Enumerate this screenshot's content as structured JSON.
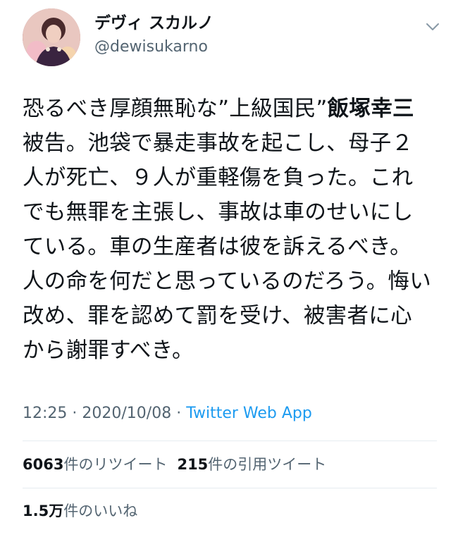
{
  "author": {
    "display_name": "デヴィ スカルノ",
    "handle": "@dewisukarno",
    "avatar_icon": "avatar-photo",
    "menu_icon": "chevron-down-icon"
  },
  "tweet": {
    "text_before": "恐るべき厚顔無恥な”上級国民”",
    "text_bold": "飯塚幸三",
    "text_after": "被告。池袋で暴走事故を起こし、母子２人が死亡、９人が重軽傷を負った。これでも無罪を主張し、事故は車のせいにしている。車の生産者は彼を訴えるべき。人の命を何だと思っているのだろう。悔い改め、罪を認めて罰を受け、被害者に心から謝罪すべき。"
  },
  "meta": {
    "time": "12:25",
    "separator": " · ",
    "date": "2020/10/08",
    "source": "Twitter Web App"
  },
  "stats": {
    "retweets_count": "6063",
    "retweets_label": "件のリツイート",
    "quotes_count": "215",
    "quotes_label": "件の引用ツイート",
    "likes_count": "1.5万",
    "likes_label": "件のいいね"
  },
  "colors": {
    "text": "#0f1419",
    "secondary": "#536471",
    "link": "#1d9bf0",
    "divider": "#e6ecf0"
  }
}
